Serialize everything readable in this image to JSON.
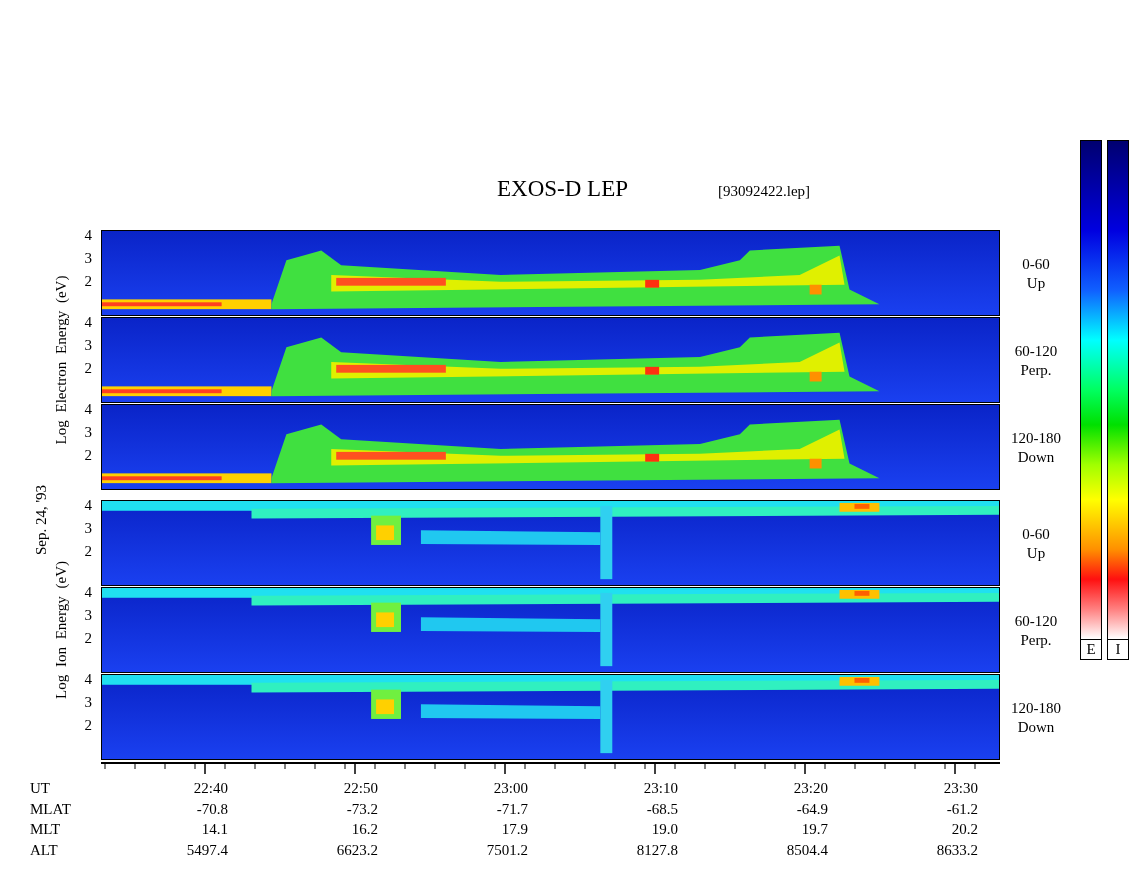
{
  "title": "EXOS-D LEP",
  "file": "[93092422.lep]",
  "date": "Sep. 24, '93",
  "groups": [
    {
      "kind": "electron",
      "axis_label": "Log  Electron  Energy (eV)",
      "panels": [
        {
          "range": "0-60",
          "direction": "Up",
          "yticks": [
            "4",
            "3",
            "2"
          ]
        },
        {
          "range": "60-120",
          "direction": "Perp.",
          "yticks": [
            "4",
            "3",
            "2"
          ]
        },
        {
          "range": "120-180",
          "direction": "Down",
          "yticks": [
            "4",
            "3",
            "2"
          ]
        }
      ]
    },
    {
      "kind": "ion",
      "axis_label": "Log  Ion  Energy (eV)",
      "panels": [
        {
          "range": "0-60",
          "direction": "Up",
          "yticks": [
            "4",
            "3",
            "2"
          ]
        },
        {
          "range": "60-120",
          "direction": "Perp.",
          "yticks": [
            "4",
            "3",
            "2"
          ]
        },
        {
          "range": "120-180",
          "direction": "Down",
          "yticks": [
            "4",
            "3",
            "2"
          ]
        }
      ]
    }
  ],
  "orbit_rows": [
    {
      "label": "UT",
      "values": [
        "22:40",
        "22:50",
        "23:00",
        "23:10",
        "23:20",
        "23:30"
      ]
    },
    {
      "label": "MLAT",
      "values": [
        "-70.8",
        "-73.2",
        "-71.7",
        "-68.5",
        "-64.9",
        "-61.2"
      ]
    },
    {
      "label": "MLT",
      "values": [
        "14.1",
        "16.2",
        "17.9",
        "19.0",
        "19.7",
        "20.2"
      ]
    },
    {
      "label": "ALT",
      "values": [
        "5497.4",
        "6623.2",
        "7501.2",
        "8127.8",
        "8504.4",
        "8633.2"
      ]
    }
  ],
  "color_scales": [
    {
      "label": "E"
    },
    {
      "label": "I"
    }
  ]
}
